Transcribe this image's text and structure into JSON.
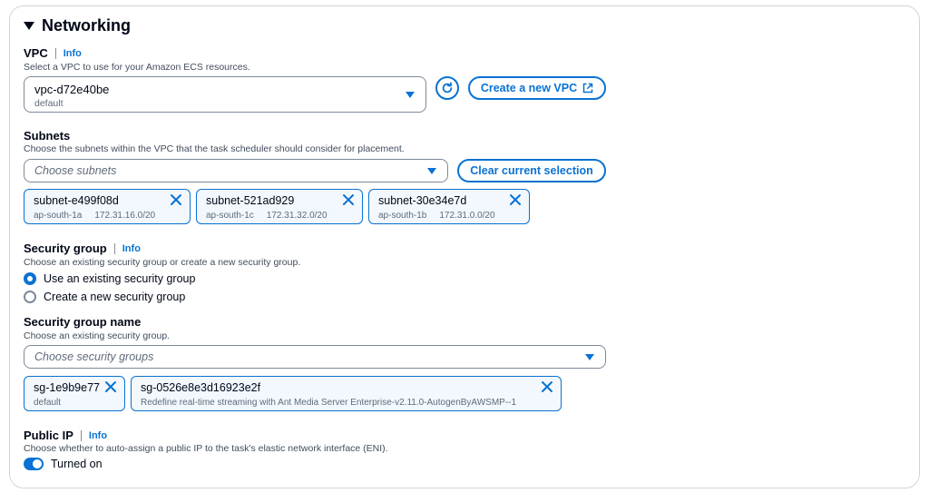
{
  "section": {
    "title": "Networking"
  },
  "vpc": {
    "label": "VPC",
    "info": "Info",
    "description": "Select a VPC to use for your Amazon ECS resources.",
    "selected_value": "vpc-d72e40be",
    "selected_sub": "default",
    "create_button": "Create a new VPC"
  },
  "subnets": {
    "label": "Subnets",
    "description": "Choose the subnets within the VPC that the task scheduler should consider for placement.",
    "placeholder": "Choose subnets",
    "clear_button": "Clear current selection",
    "tokens": [
      {
        "id": "subnet-e499f08d",
        "az": "ap-south-1a",
        "cidr": "172.31.16.0/20"
      },
      {
        "id": "subnet-521ad929",
        "az": "ap-south-1c",
        "cidr": "172.31.32.0/20"
      },
      {
        "id": "subnet-30e34e7d",
        "az": "ap-south-1b",
        "cidr": "172.31.0.0/20"
      }
    ]
  },
  "security_group": {
    "label": "Security group",
    "info": "Info",
    "description": "Choose an existing security group or create a new security group.",
    "options": [
      {
        "label": "Use an existing security group",
        "checked": true
      },
      {
        "label": "Create a new security group",
        "checked": false
      }
    ]
  },
  "security_group_name": {
    "label": "Security group name",
    "description": "Choose an existing security group.",
    "placeholder": "Choose security groups",
    "tokens": [
      {
        "id": "sg-1e9b9e77",
        "sub": "default"
      },
      {
        "id": "sg-0526e8e3d16923e2f",
        "sub": "Redefine real-time streaming with Ant Media Server Enterprise-v2.11.0-AutogenByAWSMP--1"
      }
    ]
  },
  "public_ip": {
    "label": "Public IP",
    "info": "Info",
    "description": "Choose whether to auto-assign a public IP to the task's elastic network interface (ENI).",
    "toggle_label": "Turned on",
    "enabled": true
  },
  "colors": {
    "accent": "#0972d3",
    "text": "#000716",
    "muted": "#5f6b7a",
    "token_bg": "#f2f8fd"
  }
}
